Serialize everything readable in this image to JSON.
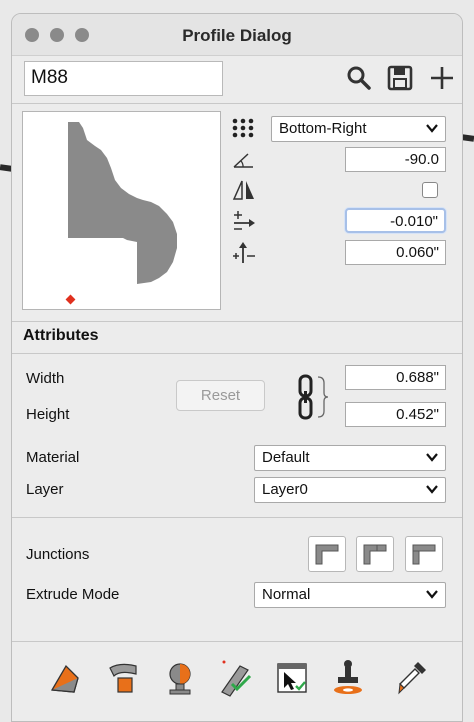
{
  "window": {
    "title": "Profile Dialog"
  },
  "profile": {
    "name": "M88"
  },
  "toolbar": {
    "search_icon": "search-icon",
    "save_icon": "save-icon",
    "add_icon": "plus-icon"
  },
  "placement": {
    "anchor": "Bottom-Right",
    "rotation": "-90.0",
    "mirror_checked": false,
    "offset_x": "-0.010\"",
    "offset_y": "0.060\""
  },
  "attributes": {
    "section_label": "Attributes",
    "width_label": "Width",
    "width_value": "0.688\"",
    "height_label": "Height",
    "height_value": "0.452\"",
    "reset_label": "Reset",
    "material_label": "Material",
    "material_value": "Default",
    "layer_label": "Layer",
    "layer_value": "Layer0",
    "junctions_label": "Junctions",
    "extrude_label": "Extrude Mode",
    "extrude_value": "Normal"
  },
  "colors": {
    "profile_fill": "#8a8a8a",
    "anchor_dot": "#e0301e",
    "accent_orange": "#e8701a",
    "accent_green": "#2fa84a"
  }
}
